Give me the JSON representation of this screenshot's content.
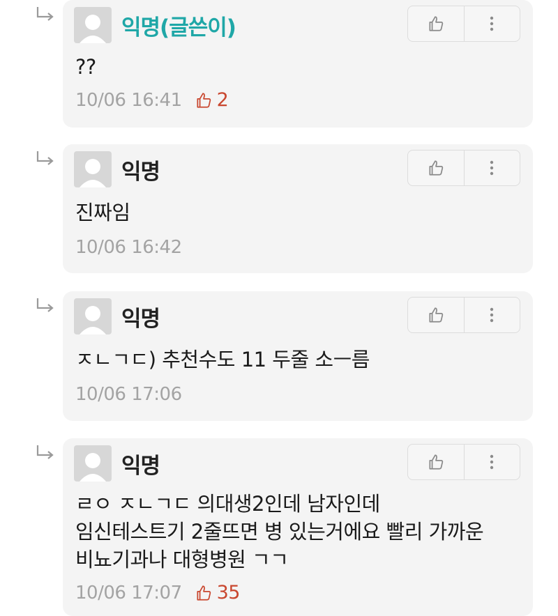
{
  "comments": [
    {
      "author": "익명(글쓴이)",
      "text_lines": [
        "??"
      ],
      "timestamp": "10/06 16:41",
      "likes": "2",
      "is_op": true
    },
    {
      "author": "익명",
      "text_lines": [
        "진짜임"
      ],
      "timestamp": "10/06 16:42",
      "likes": "",
      "is_op": false
    },
    {
      "author": "익명",
      "text_lines": [
        "ㅈㄴㄱㄷ) 추천수도 11 두줄 소ㅡ름"
      ],
      "timestamp": "10/06 17:06",
      "likes": "",
      "is_op": false
    },
    {
      "author": "익명",
      "text_lines": [
        "ㄹㅇ ㅈㄴㄱㄷ 의대생2인데 남자인데",
        "임신테스트기 2줄뜨면 병 있는거에요 빨리 가까운",
        "비뇨기과나 대형병원 ㄱㄱ"
      ],
      "timestamp": "10/06 17:07",
      "likes": "35",
      "is_op": false
    }
  ],
  "icons": {
    "reply": "reply-arrow-icon",
    "like": "thumbs-up-icon",
    "more": "more-vertical-icon",
    "avatar": "default-avatar-icon"
  },
  "colors": {
    "op_author": "#1fa7a7",
    "like_count": "#c9472f",
    "timestamp": "#a3a3a3",
    "card_bg": "#f4f4f4"
  }
}
